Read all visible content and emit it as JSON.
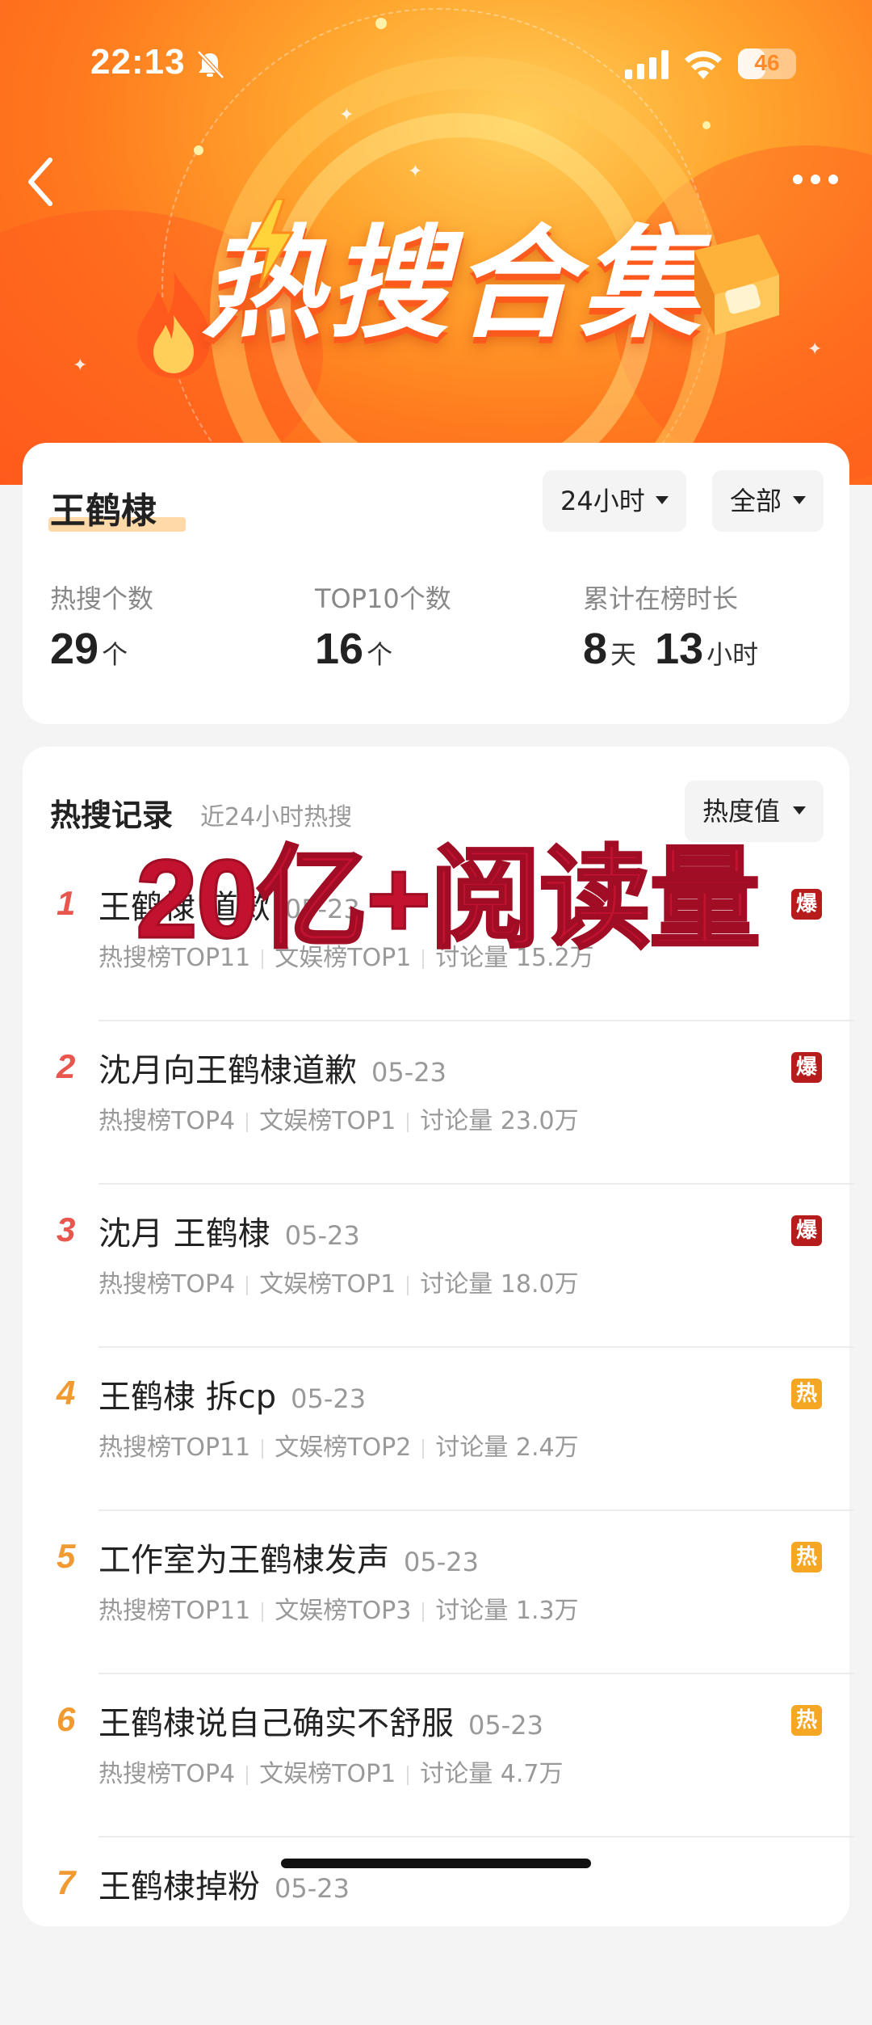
{
  "status_bar": {
    "time": "22:13",
    "battery": "46"
  },
  "banner": {
    "title": "热搜合集"
  },
  "summary": {
    "name": "王鹤棣",
    "filter_time": "24小时",
    "filter_scope": "全部",
    "stats": [
      {
        "label": "热搜个数",
        "value": "29",
        "unit": "个"
      },
      {
        "label": "TOP10个数",
        "value": "16",
        "unit": "个"
      },
      {
        "label": "累计在榜时长",
        "value1": "8",
        "unit1": "天",
        "value2": "13",
        "unit2": "小时"
      }
    ]
  },
  "records": {
    "title": "热搜记录",
    "subtitle": "近24小时热搜",
    "sort": "热度值",
    "overlay": "20亿+阅读量",
    "items": [
      {
        "rank": "1",
        "title": "王鹤棣 道歉",
        "date": "05-23",
        "meta": [
          "热搜榜TOP11",
          "文娱榜TOP1",
          "讨论量 15.2万"
        ],
        "badge": "爆"
      },
      {
        "rank": "2",
        "title": "沈月向王鹤棣道歉",
        "date": "05-23",
        "meta": [
          "热搜榜TOP4",
          "文娱榜TOP1",
          "讨论量 23.0万"
        ],
        "badge": "爆"
      },
      {
        "rank": "3",
        "title": "沈月 王鹤棣",
        "date": "05-23",
        "meta": [
          "热搜榜TOP4",
          "文娱榜TOP1",
          "讨论量 18.0万"
        ],
        "badge": "爆"
      },
      {
        "rank": "4",
        "title": "王鹤棣 拆cp",
        "date": "05-23",
        "meta": [
          "热搜榜TOP11",
          "文娱榜TOP2",
          "讨论量 2.4万"
        ],
        "badge": "热"
      },
      {
        "rank": "5",
        "title": "工作室为王鹤棣发声",
        "date": "05-23",
        "meta": [
          "热搜榜TOP11",
          "文娱榜TOP3",
          "讨论量 1.3万"
        ],
        "badge": "热"
      },
      {
        "rank": "6",
        "title": "王鹤棣说自己确实不舒服",
        "date": "05-23",
        "meta": [
          "热搜榜TOP4",
          "文娱榜TOP1",
          "讨论量 4.7万"
        ],
        "badge": "热"
      },
      {
        "rank": "7",
        "title": "王鹤棣掉粉",
        "date": "05-23"
      }
    ]
  },
  "colors": {
    "rank_top3": "#e8564e",
    "rank_other": "#f29a32",
    "badge_boom": "#b71c1c",
    "badge_hot": "#f5a623",
    "overlay": "#c2122f"
  }
}
